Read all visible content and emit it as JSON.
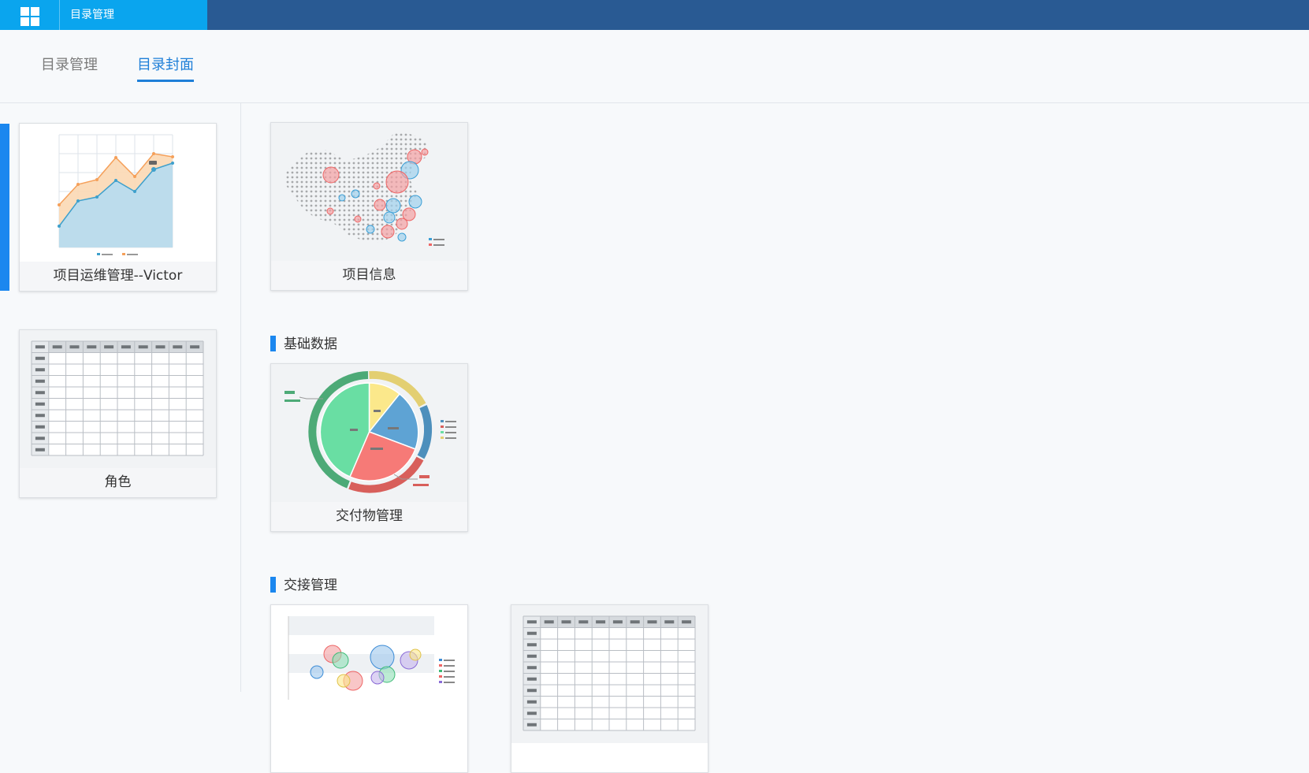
{
  "topbar": {
    "title": "目录管理",
    "home_icon": "grid-icon"
  },
  "tabs": [
    {
      "label": "目录管理",
      "active": false
    },
    {
      "label": "目录封面",
      "active": true
    }
  ],
  "sidebar": {
    "cards": [
      {
        "label": "项目运维管理--Victor",
        "thumbnail": "area-line-chart",
        "selected": true
      },
      {
        "label": "角色",
        "thumbnail": "table-grid"
      }
    ]
  },
  "main": {
    "ungrouped_cards": [
      {
        "label": "项目信息",
        "thumbnail": "china-bubble-map"
      }
    ],
    "sections": [
      {
        "title": "基础数据",
        "cards": [
          {
            "label": "交付物管理",
            "thumbnail": "pie-chart"
          }
        ]
      },
      {
        "title": "交接管理",
        "cards": [
          {
            "label": "",
            "thumbnail": "bubble-chart"
          },
          {
            "label": "",
            "thumbnail": "table-grid"
          }
        ]
      }
    ]
  },
  "colors": {
    "topbar": "#295a93",
    "topbar_tab": "#0aa5ee",
    "accent": "#1e7fd8",
    "section_marker": "#1b87ef"
  }
}
